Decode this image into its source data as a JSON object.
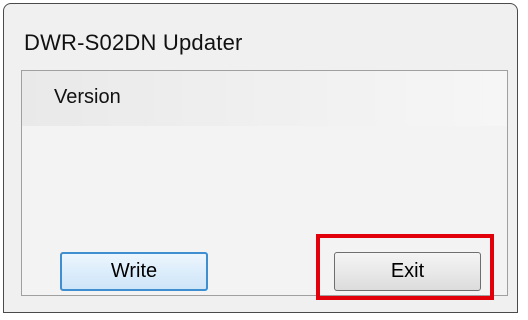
{
  "window": {
    "title": "DWR-S02DN Updater"
  },
  "content": {
    "version_label": "Version"
  },
  "buttons": {
    "write_label": "Write",
    "exit_label": "Exit"
  },
  "annotation": {
    "highlight_color": "#e2000a"
  }
}
